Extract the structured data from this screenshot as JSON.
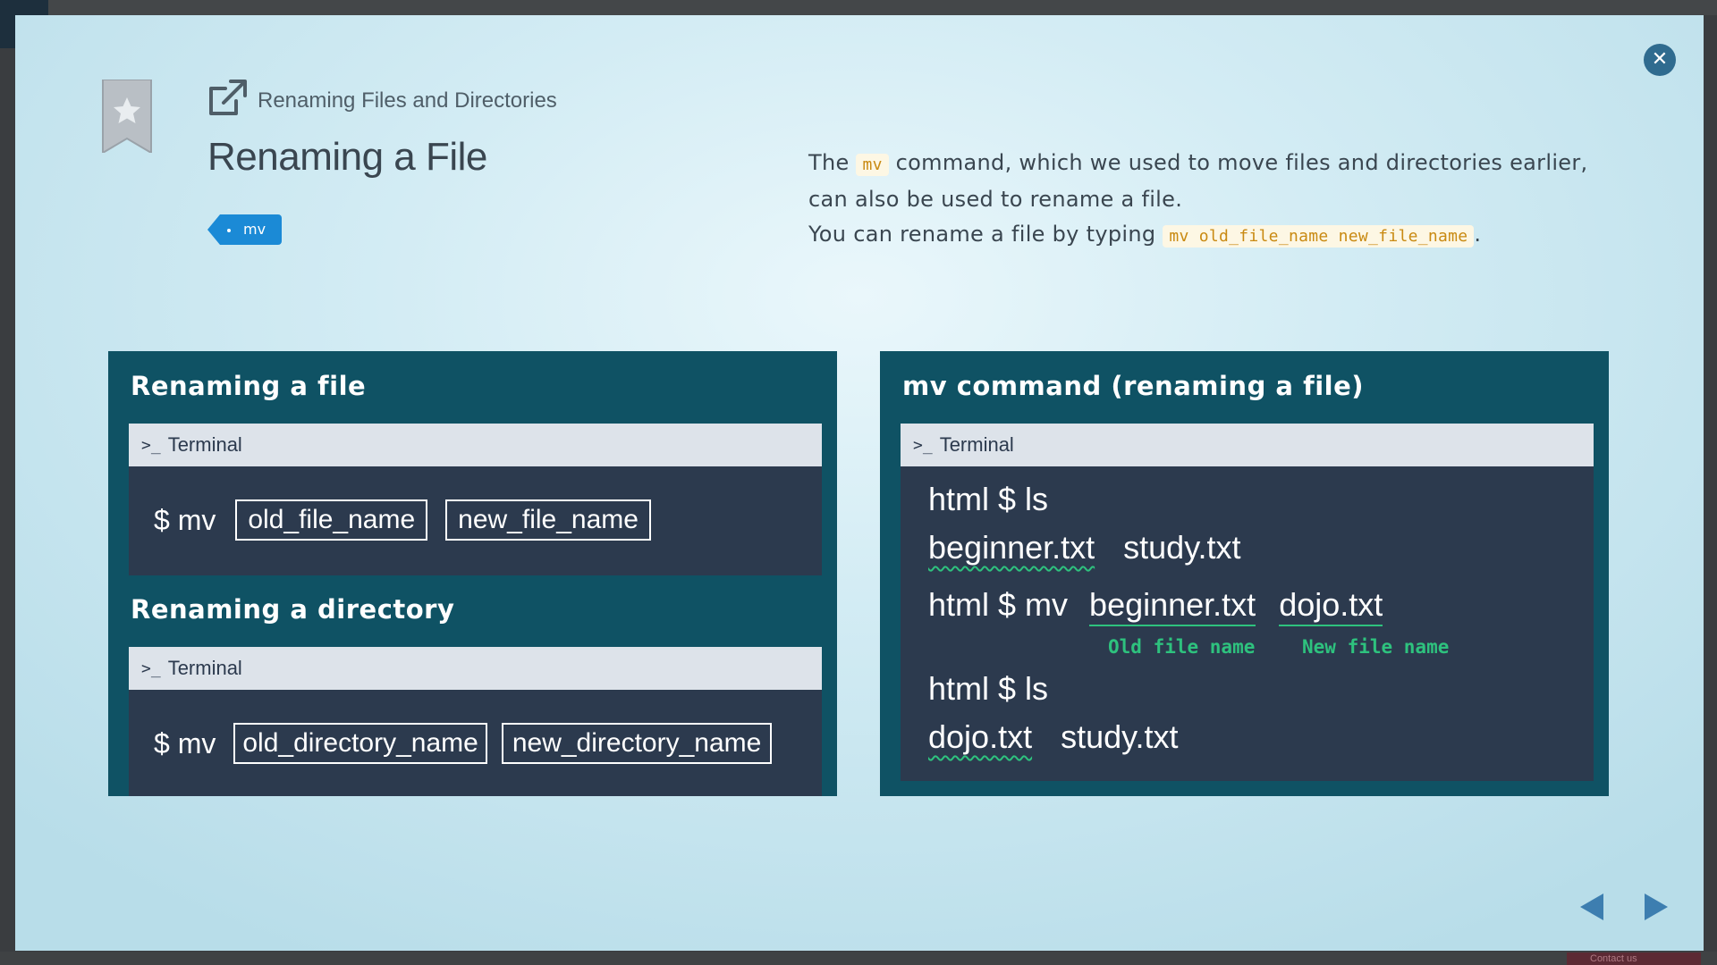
{
  "backdrop": {
    "contact_label": "Contact us"
  },
  "header": {
    "section_title": "Renaming Files and Directories",
    "page_title": "Renaming a File",
    "tag_label": "mv"
  },
  "description": {
    "line1_pre": "The ",
    "line1_code": "mv",
    "line1_post": " command, which we used to move files and directories earlier,",
    "line2": "can also be used to rename a file.",
    "line3_pre": "You can rename a file by typing ",
    "line3_code": "mv old_file_name new_file_name",
    "line3_post": "."
  },
  "left_slide": {
    "heading_file": "Renaming a file",
    "heading_dir": "Renaming a directory",
    "terminal_label": "Terminal",
    "file_cmd": {
      "prompt": "$ mv",
      "arg1": "old_file_name",
      "arg2": "new_file_name"
    },
    "dir_cmd": {
      "prompt": "$ mv",
      "arg1": "old_directory_name",
      "arg2": "new_directory_name"
    }
  },
  "right_slide": {
    "heading": "mv command (renaming a file)",
    "terminal_label": "Terminal",
    "line1": "html $ ls",
    "line2_a": "beginner.txt",
    "line2_b": "study.txt",
    "line3_prompt": "html $ mv",
    "line3_old": "beginner.txt",
    "line3_new": "dojo.txt",
    "old_label": "Old file name",
    "new_label": "New file name",
    "line4": "html $ ls",
    "line5_a": "dojo.txt",
    "line5_b": "study.txt"
  },
  "colors": {
    "slide_bg": "#0f5264",
    "terminal_bg": "#2c3a4e",
    "accent_green": "#2ec27e",
    "tag_blue": "#1b8ad6",
    "code_orange": "#c98a12",
    "nav_blue": "#3d7eb0"
  },
  "icons": {
    "close": "close-icon",
    "bookmark": "star-bookmark-icon",
    "section": "external-link-icon",
    "prev": "triangle-left-icon",
    "next": "triangle-right-icon"
  }
}
